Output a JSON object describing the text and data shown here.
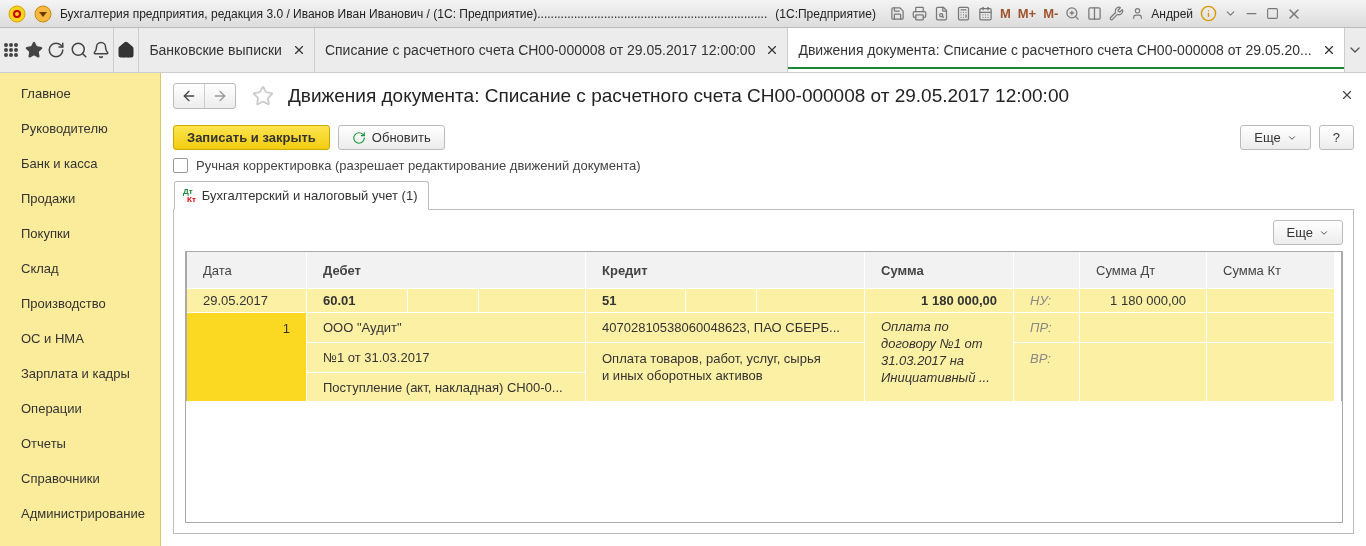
{
  "title_bar": {
    "title": "Бухгалтерия предприятия, редакция 3.0 / Иванов Иван Иванович / (1С: Предприятие).....................................................................",
    "mode": "(1С:Предприятие)",
    "memory_buttons": [
      "M",
      "M+",
      "M-"
    ],
    "user": "Андрей"
  },
  "open_tabs": [
    {
      "label": "Банковские выписки",
      "selected": false
    },
    {
      "label": "Списание с расчетного счета СН00-000008 от 29.05.2017 12:00:00",
      "selected": false
    },
    {
      "label": "Движения документа: Списание с расчетного счета СН00-000008 от 29.05.20...",
      "selected": true
    }
  ],
  "sidebar": {
    "items": [
      "Главное",
      "Руководителю",
      "Банк и касса",
      "Продажи",
      "Покупки",
      "Склад",
      "Производство",
      "ОС и НМА",
      "Зарплата и кадры",
      "Операции",
      "Отчеты",
      "Справочники",
      "Администрирование"
    ]
  },
  "form": {
    "title": "Движения документа: Списание с расчетного счета СН00-000008 от 29.05.2017 12:00:00",
    "favorite": false,
    "save_button": "Записать и закрыть",
    "refresh_button": "Обновить",
    "more_button": "Еще",
    "help_button": "?",
    "manual_edit": {
      "label": "Ручная корректировка (разрешает редактирование движений документа)",
      "checked": false
    },
    "tab": {
      "label": "Бухгалтерский и налоговый учет (1)",
      "badge_top": "Дт",
      "badge_bottom": "Кт"
    },
    "table_more_button": "Еще",
    "columns": [
      "Дата",
      "Дебет",
      "Кредит",
      "Сумма",
      "Сумма Дт",
      "Сумма Кт"
    ],
    "entry": {
      "date": "29.05.2017",
      "number": "1",
      "debit_account": "60.01",
      "debit_details": [
        "ООО \"Аудит\"",
        "№1 от 31.03.2017",
        "Поступление (акт, накладная) СН00-0..."
      ],
      "credit_account": "51",
      "credit_details": [
        "40702810538060048623, ПАО СБЕРБ...",
        "Оплата товаров, работ, услуг, сырья и иных оборотных активов"
      ],
      "amount": "1 180 000,00",
      "content": "Оплата по договору №1 от 31.03.2017 на Инициативный ...",
      "tax_labels": [
        "НУ:",
        "ПР:",
        "ВР:"
      ],
      "amount_dt": "1 180 000,00"
    }
  }
}
